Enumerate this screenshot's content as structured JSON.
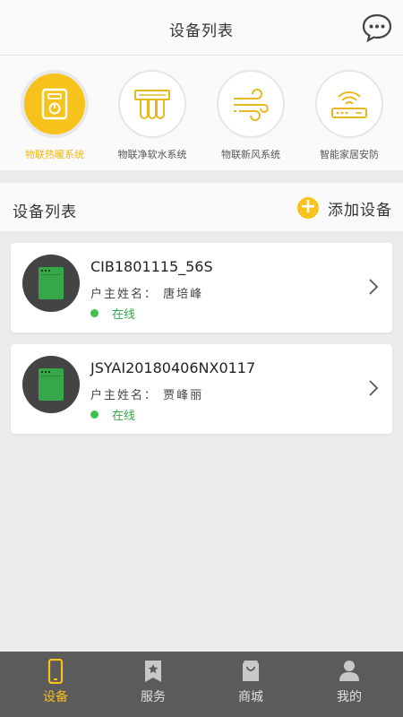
{
  "header": {
    "title": "设备列表",
    "chat_icon": "chat-bubble-icon"
  },
  "categories": [
    {
      "label": "物联热暖系统",
      "icon": "heater-icon",
      "active": true
    },
    {
      "label": "物联净软水系统",
      "icon": "water-purifier-icon",
      "active": false
    },
    {
      "label": "物联新风系统",
      "icon": "fresh-air-icon",
      "active": false
    },
    {
      "label": "智能家居安防",
      "icon": "router-icon",
      "active": false
    }
  ],
  "device_section": {
    "title": "设备列表",
    "add_label": "添加设备",
    "add_icon": "plus-circle-icon"
  },
  "devices": [
    {
      "name": "CIB1801115_56S",
      "owner": "户主姓名：  唐培峰",
      "status": "在线"
    },
    {
      "name": "JSYAI20180406NX0117",
      "owner": "户主姓名：  贾峰丽",
      "status": "在线"
    }
  ],
  "tabs": [
    {
      "label": "设备",
      "icon": "phone-icon",
      "active": true
    },
    {
      "label": "服务",
      "icon": "service-icon",
      "active": false
    },
    {
      "label": "商城",
      "icon": "shopping-bag-icon",
      "active": false
    },
    {
      "label": "我的",
      "icon": "user-icon",
      "active": false
    }
  ],
  "colors": {
    "accent": "#f7c21b",
    "online": "#3cc24b",
    "tabbar": "#5b5b5b"
  }
}
